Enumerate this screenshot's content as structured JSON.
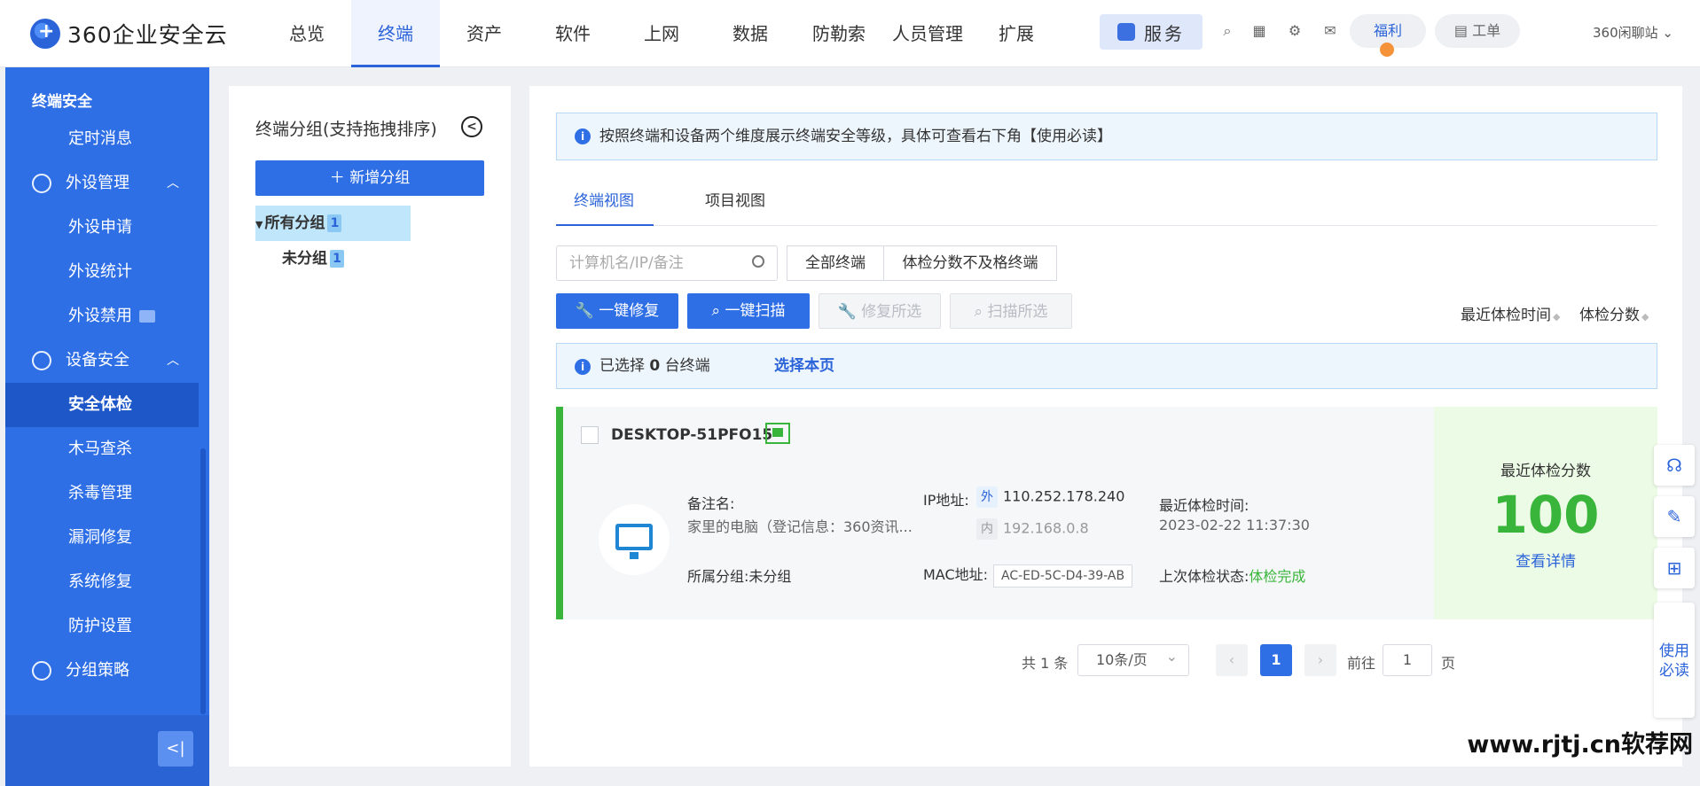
{
  "app": {
    "logo_text": "360企业安全云",
    "nav": [
      "总览",
      "终端",
      "资产",
      "软件",
      "上网",
      "数据",
      "防勒索",
      "人员管理",
      "扩展"
    ],
    "service_label": "服务",
    "welfare_label": "福利",
    "ticket_label": "工单",
    "user_label": "360闲聊站",
    "accent": "#2f6fe6",
    "success": "#39b53b"
  },
  "sidebar": {
    "section": "终端安全",
    "items": [
      {
        "label": "定时消息",
        "kind": "sub"
      },
      {
        "label": "外设管理",
        "kind": "group",
        "icon": "atom-icon"
      },
      {
        "label": "外设申请",
        "kind": "sub"
      },
      {
        "label": "外设统计",
        "kind": "sub"
      },
      {
        "label": "外设禁用",
        "kind": "sub"
      },
      {
        "label": "设备安全",
        "kind": "group",
        "icon": "shield-icon"
      },
      {
        "label": "安全体检",
        "kind": "sub",
        "active": true
      },
      {
        "label": "木马查杀",
        "kind": "sub"
      },
      {
        "label": "杀毒管理",
        "kind": "sub"
      },
      {
        "label": "漏洞修复",
        "kind": "sub"
      },
      {
        "label": "系统修复",
        "kind": "sub"
      },
      {
        "label": "防护设置",
        "kind": "sub"
      },
      {
        "label": "分组策略",
        "kind": "group",
        "icon": "layers-icon"
      }
    ]
  },
  "groups": {
    "title": "终端分组(支持拖拽排序)",
    "add_label": "新增分组",
    "tree": [
      {
        "label": "所有分组",
        "count": "1"
      },
      {
        "label": "未分组",
        "count": "1"
      }
    ]
  },
  "main": {
    "notice": "按照终端和设备两个维度展示终端安全等级，具体可查看右下角【使用必读】",
    "tabs": [
      "终端视图",
      "项目视图"
    ],
    "search_placeholder": "计算机名/IP/备注",
    "filters": [
      "全部终端",
      "体检分数不及格终端"
    ],
    "actions": [
      "一键修复",
      "一键扫描",
      "修复所选",
      "扫描所选"
    ],
    "sort": [
      "最近体检时间",
      "体检分数"
    ],
    "selected_prefix": "已选择",
    "selected_count": "0",
    "selected_suffix": "台终端",
    "select_page": "选择本页",
    "card": {
      "name": "DESKTOP-51PFO15",
      "remark_label": "备注名:",
      "remark_value": "家里的电脑（登记信息：360资讯...",
      "group_label": "所属分组:",
      "group_value": "未分组",
      "ip_label": "IP地址:",
      "ip_out_tag": "外",
      "ip_out": "110.252.178.240",
      "ip_in_tag": "内",
      "ip_in": "192.168.0.8",
      "mac_label": "MAC地址:",
      "mac": "AC-ED-5C-D4-39-AB",
      "time_label": "最近体检时间:",
      "time": "2023-02-22 11:37:30",
      "status_label": "上次体检状态:",
      "status": "体检完成",
      "score_title": "最近体检分数",
      "score": "100",
      "detail_link": "查看详情"
    },
    "pager": {
      "total": "共 1 条",
      "page_size": "10条/页",
      "current": "1",
      "goto_label": "前往",
      "goto_value": "1",
      "page_suffix": "页"
    }
  },
  "floating": {
    "read_label": "使用必读"
  },
  "watermark": "www.rjtj.cn软荐网"
}
